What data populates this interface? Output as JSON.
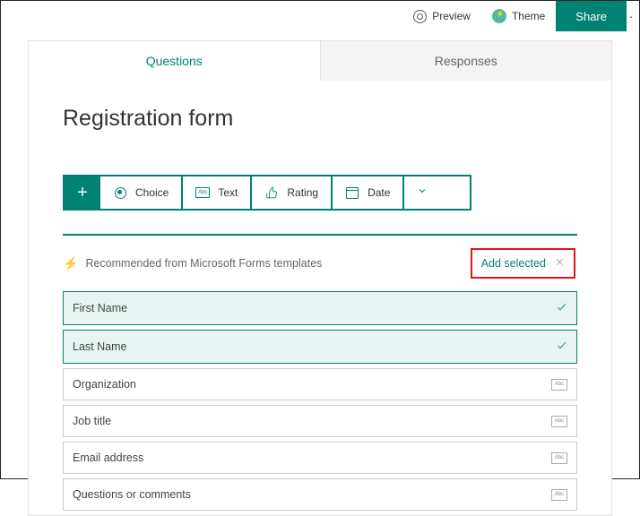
{
  "topbar": {
    "preview": "Preview",
    "theme": "Theme",
    "share": "Share"
  },
  "tabs": {
    "questions": "Questions",
    "responses": "Responses"
  },
  "form": {
    "title": "Registration form"
  },
  "toolbar": {
    "choice": "Choice",
    "text": "Text",
    "rating": "Rating",
    "date": "Date"
  },
  "recommended": {
    "label": "Recommended from Microsoft Forms templates",
    "add_selected": "Add selected",
    "items": [
      {
        "label": "First Name",
        "selected": true,
        "type": "text"
      },
      {
        "label": "Last Name",
        "selected": true,
        "type": "text"
      },
      {
        "label": "Organization",
        "selected": false,
        "type": "text"
      },
      {
        "label": "Job title",
        "selected": false,
        "type": "text"
      },
      {
        "label": "Email address",
        "selected": false,
        "type": "text"
      },
      {
        "label": "Questions or comments",
        "selected": false,
        "type": "text"
      }
    ]
  }
}
